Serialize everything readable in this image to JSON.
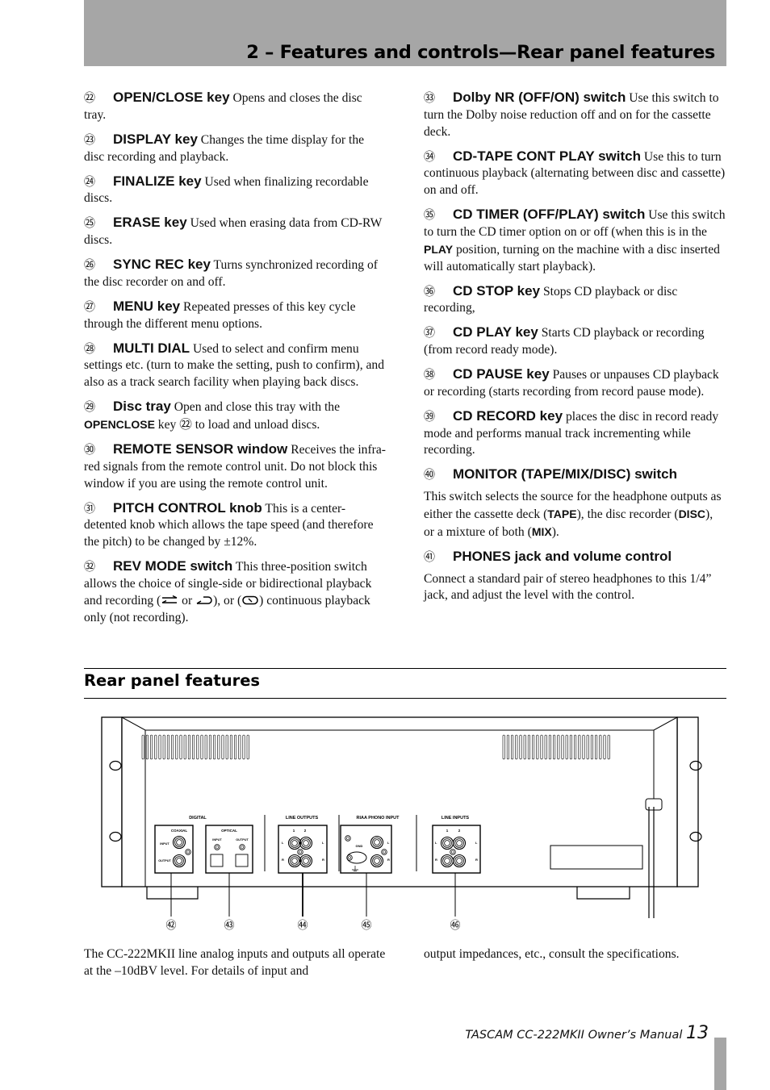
{
  "header": {
    "title": "2 – Features and controls—Rear panel features"
  },
  "left_items": [
    {
      "num": "㉒",
      "term": "OPEN/CLOSE key",
      "desc": " Opens and closes the disc tray."
    },
    {
      "num": "㉓",
      "term": "DISPLAY key",
      "desc": " Changes the time display for the disc recording and playback."
    },
    {
      "num": "㉔",
      "term": "FINALIZE key",
      "desc": " Used when finalizing recordable discs."
    },
    {
      "num": "㉕",
      "term": "ERASE key",
      "desc": " Used when erasing data from CD-RW discs."
    },
    {
      "num": "㉖",
      "term": "SYNC REC key",
      "desc": " Turns synchronized recording of the disc recorder on and off."
    },
    {
      "num": "㉗",
      "term": "MENU key",
      "desc": " Repeated presses of this key cycle through the different menu options."
    },
    {
      "num": "㉘",
      "term": "MULTI DIAL",
      "desc": " Used to select and confirm menu settings etc. (turn to make the setting, push to confirm), and also as a track search facility when playing back discs."
    },
    {
      "num": "㉙",
      "term": "Disc tray",
      "desc": " Open and close this tray with the ",
      "kw": "OPENCLOSE",
      "desc2": " key ㉒ to load and unload discs."
    },
    {
      "num": "㉚",
      "term": "REMOTE SENSOR window",
      "desc": " Receives the infra-red signals from the remote control unit. Do not block this window if you are using the remote control unit."
    },
    {
      "num": "㉛",
      "term": "PITCH CONTROL knob",
      "desc": " This is a center-detented knob which allows the tape speed (and therefore the pitch) to be changed by ±12%."
    },
    {
      "num": "㉜",
      "term": "REV MODE switch",
      "desc": " This three-position switch allows the choice of single-side or bidirectional playback and recording (",
      "mid1": " or ",
      "mid2": "), or (",
      "end": ") continuous playback only (not recording)."
    }
  ],
  "right_items": [
    {
      "num": "㉝",
      "term": "Dolby NR (OFF/ON) switch",
      "desc": " Use this switch to turn the Dolby noise reduction off and on for the cassette deck."
    },
    {
      "num": "㉞",
      "term": "CD-TAPE CONT PLAY switch",
      "desc": " Use this to turn continuous playback (alternating between disc and cassette) on and off."
    },
    {
      "num": "㉟",
      "term": "CD TIMER (OFF/PLAY) switch",
      "desc": " Use this switch to turn the CD timer option on or off (when this is in the ",
      "kw": "PLAY",
      "desc2": " position, turning on the machine with a disc inserted will automatically start playback)."
    },
    {
      "num": "㊱",
      "term": "CD STOP key",
      "desc": " Stops CD playback or disc recording,"
    },
    {
      "num": "㊲",
      "term": "CD PLAY key",
      "desc": " Starts CD playback or recording (from record ready mode)."
    },
    {
      "num": "㊳",
      "term": "CD PAUSE key",
      "desc": " Pauses or unpauses CD playback or recording (starts recording from record pause mode)."
    },
    {
      "num": "㊴",
      "term": "CD RECORD key",
      "desc": " places the disc in record ready mode and performs manual track incrementing while recording."
    },
    {
      "num": "㊵",
      "term": "MONITOR (TAPE/MIX/DISC) switch",
      "body_a": "This switch selects the source for the headphone outputs as either the cassette deck (",
      "kw_a": "TAPE",
      "body_b": "), the disc recorder (",
      "kw_b": "DISC",
      "body_c": "), or a mixture of both (",
      "kw_c": "MIX",
      "body_d": ")."
    },
    {
      "num": "㊶",
      "term": "PHONES jack and volume control",
      "body": "Connect a standard pair of stereo headphones to this 1/4” jack, and adjust the level with the control."
    }
  ],
  "rear_section": {
    "title": "Rear panel features",
    "diagram_labels": {
      "digital": "DIGITAL",
      "coaxial": "COAXIAL",
      "optical": "OPTICAL",
      "input": "INPUT",
      "output": "OUTPUT",
      "line_outputs": "LINE OUTPUTS",
      "riaa_phono_input": "RIAA PHONO INPUT",
      "line_inputs": "LINE INPUTS",
      "gnd": "GND",
      "ch1": "1",
      "ch2": "2",
      "left": "L",
      "right": "R"
    },
    "callouts": [
      "㊷",
      "㊸",
      "㊹",
      "㊺",
      "㊻"
    ]
  },
  "body_text": {
    "left": "The CC-222MKII line analog inputs and outputs all operate at the –10dBV level. For details of input and",
    "right": "output impedances, etc., consult the specifications."
  },
  "footer": {
    "manual": "TASCAM CC-222MKII Owner’s Manual",
    "page": "13"
  }
}
